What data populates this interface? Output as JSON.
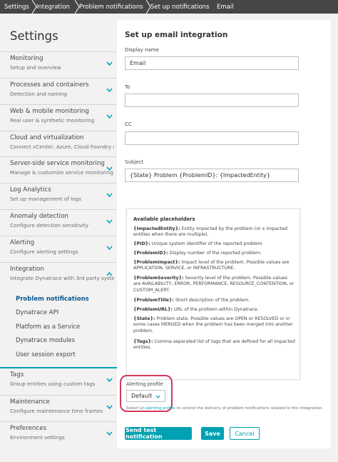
{
  "breadcrumb": {
    "items": [
      "Settings",
      "Integration",
      "Problem notifications",
      "Set up notifications",
      "Email"
    ]
  },
  "sidebar": {
    "title": "Settings",
    "items": [
      {
        "label": "Monitoring",
        "sub": "Setup and overview"
      },
      {
        "label": "Processes and containers",
        "sub": "Detection and naming"
      },
      {
        "label": "Web & mobile monitoring",
        "sub": "Real user & synthetic monitoring"
      },
      {
        "label": "Cloud and virtualization",
        "sub": "Connect vCenter, Azure, Cloud Foundry o..."
      },
      {
        "label": "Server-side service monitoring",
        "sub": "Manage & customize service monitoring"
      },
      {
        "label": "Log Analytics",
        "sub": "Set up management of logs"
      },
      {
        "label": "Anomaly detection",
        "sub": "Configure detection sensitivity"
      },
      {
        "label": "Alerting",
        "sub": "Configure alerting settings"
      },
      {
        "label": "Integration",
        "sub": "Integrate Dynatrace with 3rd party syste..."
      },
      {
        "label": "Tags",
        "sub": "Group entities using custom tags"
      },
      {
        "label": "Maintenance",
        "sub": "Configure maintenance time frames"
      },
      {
        "label": "Preferences",
        "sub": "Environment settings"
      }
    ],
    "integration_subitems": [
      "Problem notifications",
      "Dynatrace API",
      "Platform as a Service",
      "Dynatrace modules",
      "User session export"
    ]
  },
  "form": {
    "title": "Set up email integration",
    "display_name_label": "Display name",
    "display_name_value": "Email",
    "to_label": "To",
    "to_value": "",
    "cc_label": "CC",
    "cc_value": "",
    "subject_label": "Subject",
    "subject_value": "{State} Problem {ProblemID}: {ImpactedEntity}"
  },
  "placeholders": {
    "title": "Available placeholders",
    "entries": [
      {
        "key": "{ImpactedEntity}:",
        "text": " Entity impacted by the problem (or x impacted entities when there are multiple)."
      },
      {
        "key": "{PID}:",
        "text": " Unique system identifier of the reported problem."
      },
      {
        "key": "{ProblemID}:",
        "text": " Display number of the reported problem."
      },
      {
        "key": "{ProblemImpact}:",
        "text": " Impact level of the problem. Possible values are APPLICATION, SERVICE, or INFRASTRUCTURE."
      },
      {
        "key": "{ProblemSeverity}:",
        "text": " Severity level of the problem. Possible values are AVAILABILITY, ERROR, PERFORMANCE, RESOURCE_CONTENTION, or CUSTOM_ALERT."
      },
      {
        "key": "{ProblemTitle}:",
        "text": " Short description of the problem."
      },
      {
        "key": "{ProblemURL}:",
        "text": " URL of the problem within Dynatrace."
      },
      {
        "key": "{State}:",
        "text": " Problem state. Possible values are OPEN or RESOLVED or in some cases MERGED when the problem has been merged into another problem."
      },
      {
        "key": "{Tags}:",
        "text": " Comma separated list of tags that are defined for all impacted entities."
      }
    ]
  },
  "alerting": {
    "label": "Alerting profile",
    "selected": "Default",
    "hint_prefix": "Select an ",
    "hint_link": "alerting profile",
    "hint_suffix": " to control the delivery of problem notifications related to this integration."
  },
  "buttons": {
    "test": "Send test notification",
    "save": "Save",
    "cancel": "Cancel"
  },
  "colors": {
    "accent": "#00a1b2",
    "highlight": "#d0395b",
    "breadcrumb_bg": "#454646"
  }
}
